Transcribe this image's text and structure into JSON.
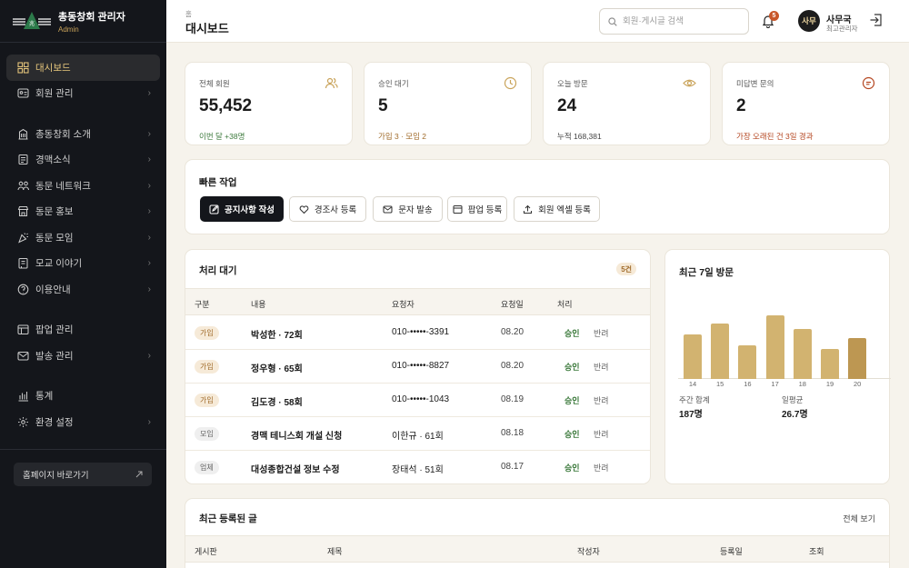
{
  "app": {
    "title": "총동창회 관리자",
    "subtitle": "Admin"
  },
  "sidebar": {
    "items": [
      {
        "label": "대시보드",
        "icon": "dashboard-icon",
        "chevron": false,
        "active": true
      },
      {
        "label": "회원 관리",
        "icon": "member-card-icon",
        "chevron": true
      },
      {
        "label": "총동창회 소개",
        "icon": "building-icon",
        "chevron": true
      },
      {
        "label": "경맥소식",
        "icon": "news-icon",
        "chevron": true
      },
      {
        "label": "동문 네트워크",
        "icon": "network-icon",
        "chevron": true
      },
      {
        "label": "동문 홍보",
        "icon": "store-icon",
        "chevron": true
      },
      {
        "label": "동문 모임",
        "icon": "party-icon",
        "chevron": true
      },
      {
        "label": "모교 이야기",
        "icon": "book-icon",
        "chevron": true
      },
      {
        "label": "이용안내",
        "icon": "help-icon",
        "chevron": true
      },
      {
        "label": "팝업 관리",
        "icon": "popup-icon",
        "chevron": false
      },
      {
        "label": "발송 관리",
        "icon": "mail-icon",
        "chevron": true
      },
      {
        "label": "통계",
        "icon": "stats-icon",
        "chevron": false
      },
      {
        "label": "환경 설정",
        "icon": "gear-icon",
        "chevron": true
      }
    ],
    "home_link": "홈페이지 바로가기"
  },
  "header": {
    "breadcrumb": "홈",
    "title": "대시보드",
    "search_placeholder": "회원·게시글 검색",
    "notification_count": "5",
    "user": {
      "avatar": "사무",
      "name": "사무국",
      "role": "최고관리자"
    }
  },
  "stats": [
    {
      "label": "전체 회원",
      "value": "55,452",
      "sub": "이번 달 +38명",
      "sub_color": "#3c7a3c",
      "icon": "users-icon"
    },
    {
      "label": "승인 대기",
      "value": "5",
      "sub": "가입 3 · 모임 2",
      "sub_color": "#a06b2a",
      "icon": "clock-icon"
    },
    {
      "label": "오늘 방문",
      "value": "24",
      "sub": "누적 168,381",
      "sub_color": "#444444",
      "icon": "eye-icon"
    },
    {
      "label": "미답변 문의",
      "value": "2",
      "sub": "가장 오래된 건 3일 경과",
      "sub_color": "#b4451f",
      "icon": "chat-icon"
    }
  ],
  "quick": {
    "title": "빠른 작업",
    "buttons": [
      "공지사항 작성",
      "경조사 등록",
      "문자 발송",
      "팝업 등록",
      "회원 엑셀 등록"
    ]
  },
  "pending": {
    "title": "처리 대기",
    "badge": "5건",
    "columns": [
      "구분",
      "내용",
      "요청자",
      "요청일",
      "처리"
    ],
    "rows": [
      {
        "type": "가입",
        "content": "박성한 · 72회",
        "requester": "010-•••••-3391",
        "date": "08.20"
      },
      {
        "type": "가입",
        "content": "정우형 · 65회",
        "requester": "010-•••••-8827",
        "date": "08.20"
      },
      {
        "type": "가입",
        "content": "김도경 · 58회",
        "requester": "010-•••••-1043",
        "date": "08.19"
      },
      {
        "type": "모임",
        "content": "경맥 테니스회 개설 신청",
        "requester": "이한규 · 61회",
        "date": "08.18"
      },
      {
        "type": "업체",
        "content": "대성종합건설 정보 수정",
        "requester": "장태석 · 51회",
        "date": "08.17"
      }
    ],
    "approve": "승인",
    "reject": "반려"
  },
  "visits": {
    "title": "최근 7일 방문",
    "weekly_label": "주간 합계",
    "weekly_value": "187명",
    "avg_label": "일평균",
    "avg_value": "26.7명"
  },
  "chart_data": {
    "type": "bar",
    "title": "최근 7일 방문",
    "categories": [
      "14",
      "15",
      "16",
      "17",
      "18",
      "19",
      "20"
    ],
    "values": [
      24,
      30,
      18,
      34,
      27,
      16,
      22
    ],
    "ylim": [
      0,
      40
    ],
    "colors": {
      "bar": "#d2b370",
      "highlight": "#bd9752"
    }
  },
  "recent": {
    "title": "최근 등록된 글",
    "view_all": "전체 보기",
    "columns": [
      "게시판",
      "제목",
      "작성자",
      "등록일",
      "조회"
    ]
  }
}
